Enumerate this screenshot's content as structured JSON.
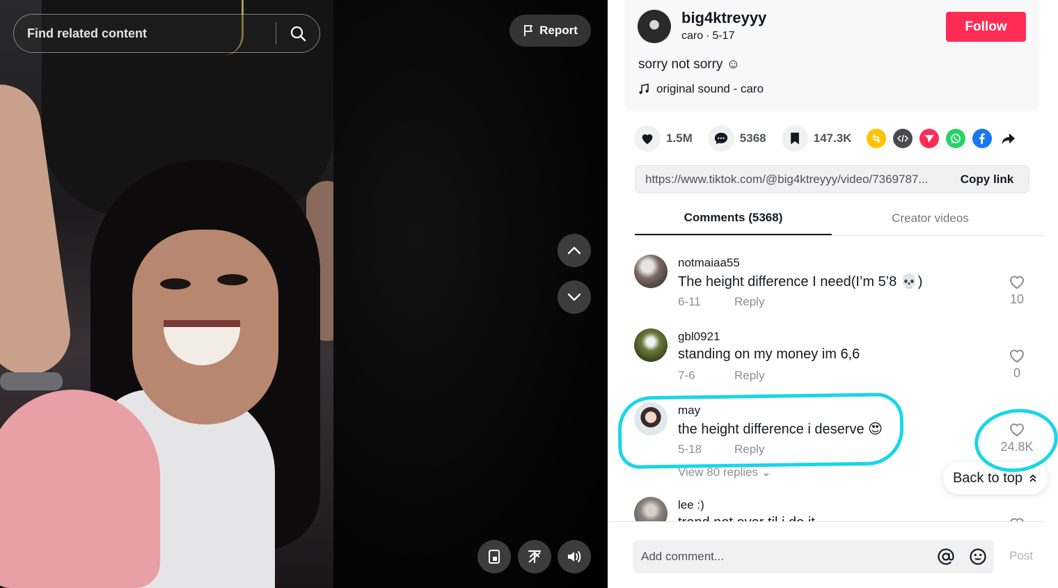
{
  "search": {
    "placeholder": "Find related content"
  },
  "video": {
    "report_label": "Report"
  },
  "post": {
    "username": "big4ktreyyy",
    "nickname": "caro",
    "date": "5-17",
    "follow_label": "Follow",
    "caption": "sorry not sorry ☺",
    "music": "original sound - caro"
  },
  "stats": {
    "likes": "1.5M",
    "comments": "5368",
    "saves": "147.3K"
  },
  "link": {
    "url": "https://www.tiktok.com/@big4ktreyyy/video/7369787...",
    "copy_label": "Copy link"
  },
  "tabs": {
    "comments": "Comments (5368)",
    "creator": "Creator videos"
  },
  "comments": [
    {
      "user": "notmaiaa55",
      "text": "The height difference I need(I’m 5’8 💀)",
      "date": "6-11",
      "reply": "Reply",
      "likes": "10"
    },
    {
      "user": "gbl0921",
      "text": "standing on my money im 6,6",
      "date": "7-6",
      "reply": "Reply",
      "likes": "0"
    },
    {
      "user": "may",
      "text": "the height difference i deserve 😍",
      "date": "5-18",
      "reply": "Reply",
      "likes": "24.8K"
    },
    {
      "user": "lee :)",
      "text": "trend not over til i do it"
    }
  ],
  "view_replies": "View 80 replies ⌄",
  "back_to_top": "Back to top",
  "comment_box": {
    "placeholder": "Add comment...",
    "post_label": "Post"
  },
  "colors": {
    "accent": "#fe2c55",
    "highlight": "#18d6e8",
    "text": "#161823"
  }
}
